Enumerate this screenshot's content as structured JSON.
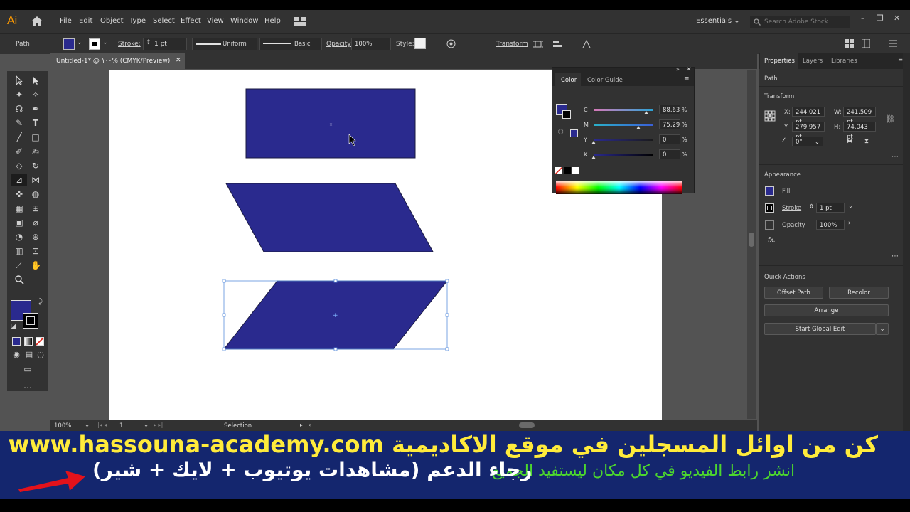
{
  "app": {
    "logo": "Ai"
  },
  "menu": [
    "File",
    "Edit",
    "Object",
    "Type",
    "Select",
    "Effect",
    "View",
    "Window",
    "Help"
  ],
  "workspace": "Essentials",
  "search": {
    "placeholder": "Search Adobe Stock"
  },
  "window_controls": [
    "–",
    "❐",
    "✕"
  ],
  "control_bar": {
    "selection_type": "Path",
    "stroke_label": "Stroke:",
    "stroke_weight": "1 pt",
    "stroke_profile": "Uniform",
    "brush": "Basic",
    "opacity_label": "Opacity:",
    "opacity_value": "100%",
    "style_label": "Style:",
    "transform_label": "Transform"
  },
  "document_tab": {
    "title": "Untitled-1* @ ١٠٠% (CMYK/Preview)",
    "close": "✕"
  },
  "status_bar": {
    "zoom": "100%",
    "artboard": "1",
    "tool": "Selection"
  },
  "color_panel": {
    "tabs": [
      "Color",
      "Color Guide"
    ],
    "channels": [
      {
        "label": "C",
        "value": "88.63",
        "unit": "%",
        "level": 0.8863
      },
      {
        "label": "M",
        "value": "75.29",
        "unit": "%",
        "level": 0.7529
      },
      {
        "label": "Y",
        "value": "0",
        "unit": "%",
        "level": 0
      },
      {
        "label": "K",
        "value": "0",
        "unit": "%",
        "level": 0
      }
    ]
  },
  "properties": {
    "tabs": [
      "Properties",
      "Layers",
      "Libraries"
    ],
    "selection": "Path",
    "transform_title": "Transform",
    "x_label": "X:",
    "x": "244.021 pt",
    "y_label": "Y:",
    "y": "279.957 pt",
    "w_label": "W:",
    "w": "241.509 pt",
    "h_label": "H:",
    "h": "74.043 pt",
    "angle": "0°",
    "appearance_title": "Appearance",
    "fill_label": "Fill",
    "stroke_label": "Stroke",
    "stroke_value": "1 pt",
    "opacity_label": "Opacity",
    "opacity_value": "100%",
    "fx_label": "fx.",
    "quick_actions_title": "Quick Actions",
    "buttons": {
      "offset_path": "Offset Path",
      "recolor": "Recolor",
      "arrange": "Arrange",
      "global_edit": "Start Global Edit"
    }
  },
  "colors": {
    "fill": "#2a2a8e",
    "shape_stroke": "#1a1a40",
    "ui_dark": "#323232",
    "banner": "#14266e"
  },
  "banner": {
    "line1": "كن من اوائل المسجلين في موقع الاكاديمية www.hassouna-academy.com",
    "line2_green": "انشر رابط الفيديو في كل مكان ليستفيد الجميع",
    "line2_white": "رجاء الدعم (مشاهدات يوتيوب + لايك + شير)"
  }
}
